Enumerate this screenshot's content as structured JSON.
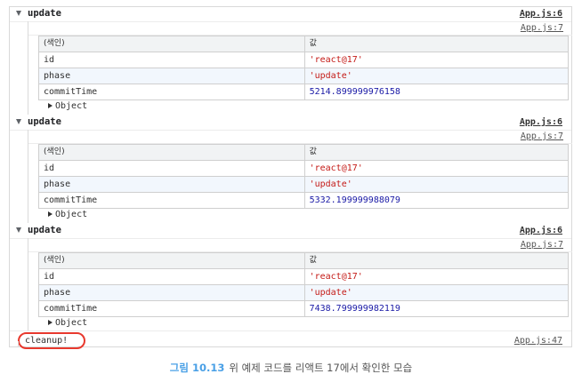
{
  "console": {
    "groups": [
      {
        "title": "update",
        "header_source": "App.js:6",
        "table_source": "App.js:7",
        "table": {
          "headers": [
            "(색인)",
            "값"
          ],
          "rows": [
            {
              "key": "id",
              "value": "'react@17'"
            },
            {
              "key": "phase",
              "value": "'update'"
            },
            {
              "key": "commitTime",
              "value": "5214.899999976158"
            }
          ]
        },
        "object_label": "Object"
      },
      {
        "title": "update",
        "header_source": "App.js:6",
        "table_source": "App.js:7",
        "table": {
          "headers": [
            "(색인)",
            "값"
          ],
          "rows": [
            {
              "key": "id",
              "value": "'react@17'"
            },
            {
              "key": "phase",
              "value": "'update'"
            },
            {
              "key": "commitTime",
              "value": "5332.199999988079"
            }
          ]
        },
        "object_label": "Object"
      },
      {
        "title": "update",
        "header_source": "App.js:6",
        "table_source": "App.js:7",
        "table": {
          "headers": [
            "(색인)",
            "값"
          ],
          "rows": [
            {
              "key": "id",
              "value": "'react@17'"
            },
            {
              "key": "phase",
              "value": "'update'"
            },
            {
              "key": "commitTime",
              "value": "7438.799999982119"
            }
          ]
        },
        "object_label": "Object"
      }
    ],
    "cleanup": {
      "text": "cleanup!",
      "source": "App.js:47"
    }
  },
  "caption": {
    "label": "그림 10.13",
    "text": "위 예제 코드를 리액트 17에서 확인한 모습"
  },
  "colors": {
    "string_value": "#c41a16",
    "number_value": "#1a1aa6",
    "highlight_circle": "#e8392e",
    "caption_label": "#4aa0e6"
  }
}
